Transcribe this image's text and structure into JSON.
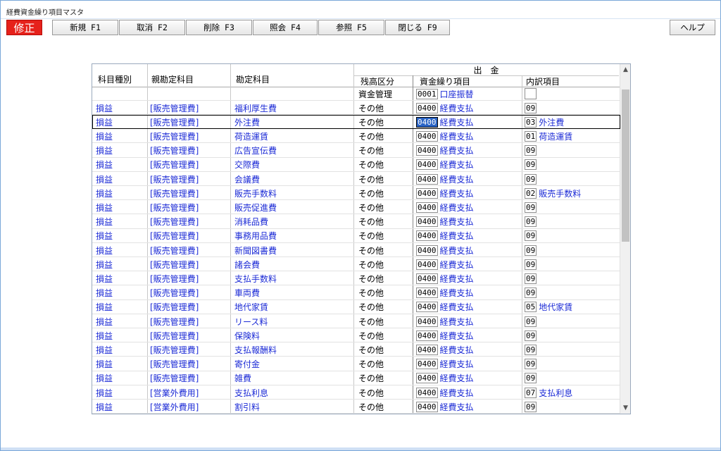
{
  "window": {
    "title": "経費資金繰り項目マスタ"
  },
  "toolbar": {
    "mode": "修正",
    "buttons": [
      "新規 F1",
      "取消 F2",
      "削除 F3",
      "照会 F4",
      "参照 F5",
      "閉じる F9"
    ],
    "help": "ヘルプ"
  },
  "grid": {
    "headers": {
      "kamoku_shubetsu": "科目種別",
      "oya_kanjo": "親勘定科目",
      "kanjo": "勘定科目",
      "shukkin": "出　金",
      "zandaka": "残高区分",
      "shikin": "資金繰り項目",
      "uchiwake": "内訳項目"
    },
    "first_row": {
      "zandaka": "資金管理",
      "code": "0001",
      "name": "口座振替"
    },
    "rows": [
      {
        "type": "損益",
        "parent": "[販売管理費]",
        "account": "福利厚生費",
        "zan": "その他",
        "code": "0400",
        "item": "経費支払",
        "ucode": "09",
        "uname": ""
      },
      {
        "type": "損益",
        "parent": "[販売管理費]",
        "account": "外注費",
        "zan": "その他",
        "code": "0400",
        "item": "経費支払",
        "ucode": "03",
        "uname": "外注費"
      },
      {
        "type": "損益",
        "parent": "[販売管理費]",
        "account": "荷造運賃",
        "zan": "その他",
        "code": "0400",
        "item": "経費支払",
        "ucode": "01",
        "uname": "荷造運賃"
      },
      {
        "type": "損益",
        "parent": "[販売管理費]",
        "account": "広告宣伝費",
        "zan": "その他",
        "code": "0400",
        "item": "経費支払",
        "ucode": "09",
        "uname": ""
      },
      {
        "type": "損益",
        "parent": "[販売管理費]",
        "account": "交際費",
        "zan": "その他",
        "code": "0400",
        "item": "経費支払",
        "ucode": "09",
        "uname": ""
      },
      {
        "type": "損益",
        "parent": "[販売管理費]",
        "account": "会議費",
        "zan": "その他",
        "code": "0400",
        "item": "経費支払",
        "ucode": "09",
        "uname": ""
      },
      {
        "type": "損益",
        "parent": "[販売管理費]",
        "account": "販売手数料",
        "zan": "その他",
        "code": "0400",
        "item": "経費支払",
        "ucode": "02",
        "uname": "販売手数料"
      },
      {
        "type": "損益",
        "parent": "[販売管理費]",
        "account": "販売促進費",
        "zan": "その他",
        "code": "0400",
        "item": "経費支払",
        "ucode": "09",
        "uname": ""
      },
      {
        "type": "損益",
        "parent": "[販売管理費]",
        "account": "消耗品費",
        "zan": "その他",
        "code": "0400",
        "item": "経費支払",
        "ucode": "09",
        "uname": ""
      },
      {
        "type": "損益",
        "parent": "[販売管理費]",
        "account": "事務用品費",
        "zan": "その他",
        "code": "0400",
        "item": "経費支払",
        "ucode": "09",
        "uname": ""
      },
      {
        "type": "損益",
        "parent": "[販売管理費]",
        "account": "新聞図書費",
        "zan": "その他",
        "code": "0400",
        "item": "経費支払",
        "ucode": "09",
        "uname": ""
      },
      {
        "type": "損益",
        "parent": "[販売管理費]",
        "account": "諸会費",
        "zan": "その他",
        "code": "0400",
        "item": "経費支払",
        "ucode": "09",
        "uname": ""
      },
      {
        "type": "損益",
        "parent": "[販売管理費]",
        "account": "支払手数料",
        "zan": "その他",
        "code": "0400",
        "item": "経費支払",
        "ucode": "09",
        "uname": ""
      },
      {
        "type": "損益",
        "parent": "[販売管理費]",
        "account": "車両費",
        "zan": "その他",
        "code": "0400",
        "item": "経費支払",
        "ucode": "09",
        "uname": ""
      },
      {
        "type": "損益",
        "parent": "[販売管理費]",
        "account": "地代家賃",
        "zan": "その他",
        "code": "0400",
        "item": "経費支払",
        "ucode": "05",
        "uname": "地代家賃"
      },
      {
        "type": "損益",
        "parent": "[販売管理費]",
        "account": "リース料",
        "zan": "その他",
        "code": "0400",
        "item": "経費支払",
        "ucode": "09",
        "uname": ""
      },
      {
        "type": "損益",
        "parent": "[販売管理費]",
        "account": "保険料",
        "zan": "その他",
        "code": "0400",
        "item": "経費支払",
        "ucode": "09",
        "uname": ""
      },
      {
        "type": "損益",
        "parent": "[販売管理費]",
        "account": "支払報酬料",
        "zan": "その他",
        "code": "0400",
        "item": "経費支払",
        "ucode": "09",
        "uname": ""
      },
      {
        "type": "損益",
        "parent": "[販売管理費]",
        "account": "寄付金",
        "zan": "その他",
        "code": "0400",
        "item": "経費支払",
        "ucode": "09",
        "uname": ""
      },
      {
        "type": "損益",
        "parent": "[販売管理費]",
        "account": "雑費",
        "zan": "その他",
        "code": "0400",
        "item": "経費支払",
        "ucode": "09",
        "uname": ""
      },
      {
        "type": "損益",
        "parent": "[営業外費用]",
        "account": "支払利息",
        "zan": "その他",
        "code": "0400",
        "item": "経費支払",
        "ucode": "07",
        "uname": "支払利息"
      },
      {
        "type": "損益",
        "parent": "[営業外費用]",
        "account": "割引料",
        "zan": "その他",
        "code": "0400",
        "item": "経費支払",
        "ucode": "09",
        "uname": ""
      }
    ],
    "selected_row": 1,
    "scroll": {
      "up": "▲",
      "down": "▼"
    }
  }
}
